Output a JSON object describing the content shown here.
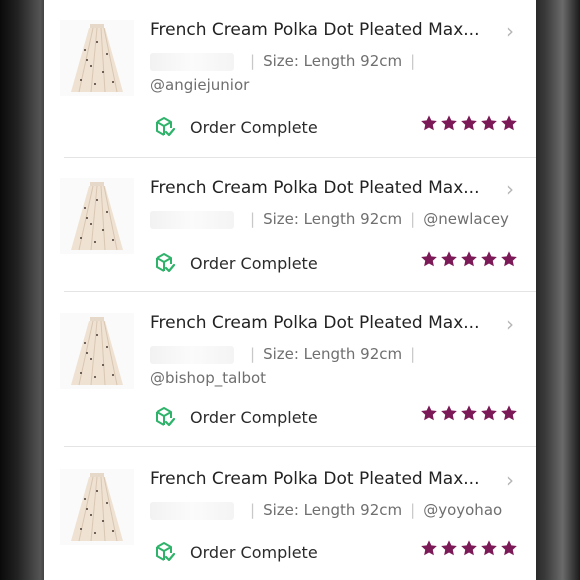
{
  "orders": [
    {
      "title": "French Cream Polka Dot Pleated Max...",
      "size": "Size: Length 92cm",
      "buyer": "@angiejunior",
      "status": "Order Complete",
      "rating": 5
    },
    {
      "title": "French Cream Polka Dot Pleated Max...",
      "size": "Size: Length 92cm",
      "buyer": "@newlacey",
      "status": "Order Complete",
      "rating": 5
    },
    {
      "title": "French Cream Polka Dot Pleated Max...",
      "size": "Size: Length 92cm",
      "buyer": "@bishop_talbot",
      "status": "Order Complete",
      "rating": 5
    },
    {
      "title": "French Cream Polka Dot Pleated Max...",
      "size": "Size: Length 92cm",
      "buyer": "@yoyohao",
      "status": "Order Complete",
      "rating": 5
    }
  ],
  "icons": {
    "status": "package-check-icon",
    "rating": "star-icon",
    "nav": "chevron-right-icon",
    "thumbnail": "skirt-thumbnail-icon"
  },
  "colors": {
    "star": "#7b1a57",
    "status_icon": "#2fb36b",
    "chevron": "#b6b6b6",
    "text": "#222222",
    "meta": "#6f6f6f"
  }
}
